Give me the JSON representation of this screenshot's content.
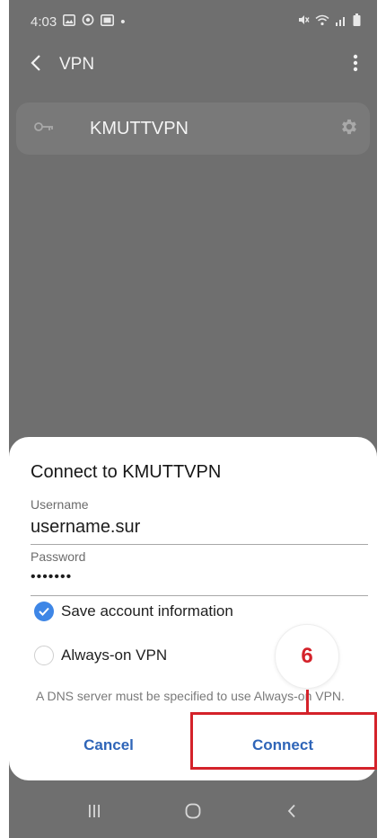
{
  "status_bar": {
    "time": "4:03",
    "dot": "•",
    "left_icons": [
      "gallery-icon",
      "sync-icon",
      "image-icon"
    ],
    "right_icons": [
      "mute-icon",
      "wifi-icon",
      "signal-icon",
      "battery-icon"
    ]
  },
  "app_bar": {
    "back_icon": "back-arrow-icon",
    "title": "VPN",
    "more_icon": "more-vertical-icon"
  },
  "vpn_list": [
    {
      "name": "KMUTTVPN",
      "icon": "key-icon",
      "settings_icon": "gear-icon"
    }
  ],
  "dialog": {
    "title": "Connect to KMUTTVPN",
    "username_label": "Username",
    "username_value": "username.sur",
    "password_label": "Password",
    "password_value": "•••••••",
    "save_account": {
      "label": "Save account information",
      "checked": true
    },
    "always_on": {
      "label": "Always-on VPN",
      "checked": false
    },
    "dns_note": "A DNS server must be specified to use Always-on VPN.",
    "cancel_label": "Cancel",
    "connect_label": "Connect"
  },
  "annotation": {
    "step_number": "6",
    "color": "#d4222a"
  },
  "nav_bar": {
    "items": [
      "recent-apps-icon",
      "home-icon",
      "back-icon"
    ]
  },
  "colors": {
    "accent_blue": "#3e86e6",
    "button_text": "#2f65b8",
    "dim_overlay": "#6f6f6f"
  }
}
